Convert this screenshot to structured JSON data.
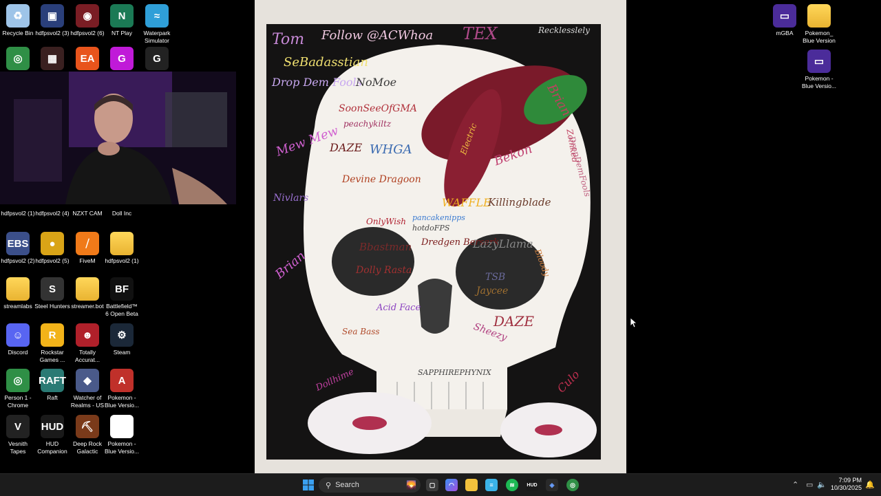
{
  "desktop": {
    "left_icons": [
      {
        "id": "recycle-bin",
        "label": "Recycle Bin",
        "glyph": "♻",
        "color": "#9ec4e8"
      },
      {
        "id": "hdfpsvol2-3",
        "label": "hdfpsvol2 (3)",
        "glyph": "▣",
        "color": "#2a3f7a"
      },
      {
        "id": "hdfpsvol2-6",
        "label": "hdfpsvol2 (6)",
        "glyph": "◉",
        "color": "#7a1d24"
      },
      {
        "id": "nt-play",
        "label": "NT Play",
        "glyph": "N",
        "color": "#1b7a55"
      },
      {
        "id": "waterpark-simulator",
        "label": "Waterpark Simulator",
        "glyph": "≈",
        "color": "#2f9fd8"
      },
      {
        "id": "chrome",
        "label": "",
        "glyph": "◎",
        "color": "#2f8f46"
      },
      {
        "id": "game-app",
        "label": "",
        "glyph": "▦",
        "color": "#3a2020"
      },
      {
        "id": "ea",
        "label": "",
        "glyph": "EA",
        "color": "#e8541c"
      },
      {
        "id": "gh-app",
        "label": "",
        "glyph": "G",
        "color": "#c01ad8"
      },
      {
        "id": "logitech",
        "label": "",
        "glyph": "G",
        "color": "#222222"
      },
      {
        "id": "hdfpsvol2-1",
        "label": "hdfpsvol2 (1)",
        "glyph": "",
        "color": "#333"
      },
      {
        "id": "hdfpsvol2-4",
        "label": "hdfpsvol2 (4)",
        "glyph": "",
        "color": "#333"
      },
      {
        "id": "nzxt-cam",
        "label": "NZXT CAM",
        "glyph": "",
        "color": "#333"
      },
      {
        "id": "doll-inc",
        "label": "Doll Inc",
        "glyph": "",
        "color": "#333"
      },
      {
        "id": "hdfpsvol2-2",
        "label": "hdfpsvol2 (2)",
        "glyph": "EBS",
        "color": "#3b4f8a"
      },
      {
        "id": "hdfpsvol2-5",
        "label": "hdfpsvol2 (5)",
        "glyph": "●",
        "color": "#d9a417"
      },
      {
        "id": "fivem",
        "label": "FiveM",
        "glyph": "⧸",
        "color": "#f07a19"
      },
      {
        "id": "hdfpsvol2-1b",
        "label": "hdfpsvol2 (1)",
        "glyph": "",
        "color": "folder"
      },
      {
        "id": "streamlabs",
        "label": "streamlabs",
        "glyph": "",
        "color": "folder"
      },
      {
        "id": "steel-hunters",
        "label": "Steel Hunters",
        "glyph": "S",
        "color": "#333333"
      },
      {
        "id": "streamer-bot",
        "label": "streamer.bot",
        "glyph": "",
        "color": "folder"
      },
      {
        "id": "battlefield-6",
        "label": "Battlefield™ 6 Open Beta",
        "glyph": "BF",
        "color": "#111111"
      },
      {
        "id": "discord",
        "label": "Discord",
        "glyph": "☺",
        "color": "#5865f2"
      },
      {
        "id": "rockstar",
        "label": "Rockstar Games ...",
        "glyph": "R",
        "color": "#f2b319"
      },
      {
        "id": "totally-accurate",
        "label": "Totally Accurat...",
        "glyph": "☻",
        "color": "#b0202a"
      },
      {
        "id": "steam",
        "label": "Steam",
        "glyph": "⚙",
        "color": "#1b2838"
      },
      {
        "id": "person1-chrome",
        "label": "Person 1 - Chrome",
        "glyph": "◎",
        "color": "#2f8f46"
      },
      {
        "id": "raft",
        "label": "Raft",
        "glyph": "RAFT",
        "color": "#2a7a74"
      },
      {
        "id": "watcher-of-realms",
        "label": "Watcher of Realms - US",
        "glyph": "◆",
        "color": "#4a5a8a"
      },
      {
        "id": "pokemon-blue-1",
        "label": "Pokemon - Blue Versio...",
        "glyph": "A",
        "color": "#c0302a"
      },
      {
        "id": "vesnith-tapes",
        "label": "Vesnith Tapes",
        "glyph": "V",
        "color": "#222222"
      },
      {
        "id": "hud-companion",
        "label": "HUD Companion",
        "glyph": "HUD",
        "color": "#1a1a1a"
      },
      {
        "id": "deep-rock-galactic",
        "label": "Deep Rock Galactic",
        "glyph": "⛏",
        "color": "#7a3a1a"
      },
      {
        "id": "pokemon-blue-2",
        "label": "Pokemon - Blue Versio...",
        "glyph": "",
        "color": "#ffffff"
      }
    ],
    "right_icons": [
      {
        "id": "mgba",
        "label": "mGBA",
        "glyph": "▭",
        "color": "#4b2c9a"
      },
      {
        "id": "pokemon-blue-folder",
        "label": "Pokemon_ Blue Version",
        "glyph": "",
        "color": "folder"
      },
      {
        "id": "pokemon-blue-3",
        "label": "Pokemon - Blue Versio...",
        "glyph": "▭",
        "color": "#4b2c9a"
      }
    ]
  },
  "painting": {
    "texts": [
      "Tom",
      "Follow @ACWhoa",
      "TEX",
      "Recklesslely",
      "SeBadasstian",
      "Drop Dem Fools",
      "NoMoe",
      "SoonSeeOfGMA",
      "peachykiltz",
      "DAZE",
      "WHGA",
      "Devine Dragoon",
      "Mew Mew",
      "Nivlars",
      "Brian",
      "Electric",
      "Bekon",
      "WAFFLE",
      "Killingblade",
      "OnlyWish",
      "pancakenipps",
      "hotdoFPS",
      "Bbastman",
      "Dredgen Berserk",
      "LazyLlama",
      "Dolly Rasta",
      "TSB",
      "Jaycee",
      "Acid Face",
      "DAZE",
      "Sea Bass",
      "SAPPHIREPHYNIX",
      "Dollhime",
      "Zoinked",
      "DropDemFools",
      "Culo",
      "Sheezy",
      "Brian",
      "Bloody"
    ]
  },
  "taskbar": {
    "search_placeholder": "Search",
    "apps": [
      "start",
      "copilot",
      "task-view",
      "edge",
      "file-explorer",
      "notepad",
      "spotify",
      "hud",
      "sidequest",
      "chrome"
    ],
    "time": "7:09 PM",
    "date": "10/30/2025"
  }
}
